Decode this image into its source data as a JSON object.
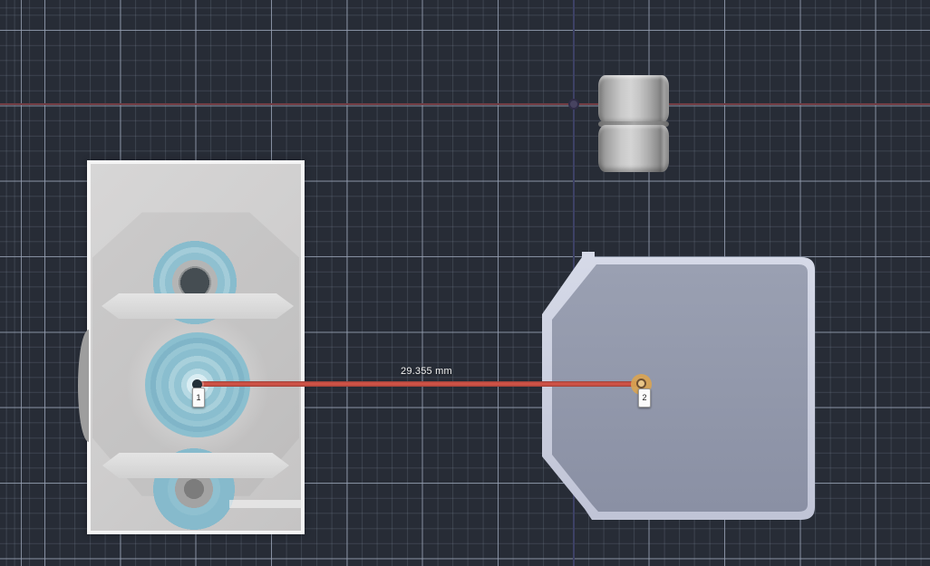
{
  "measurement": {
    "value": "29.355 mm",
    "point1": "1",
    "point2": "2"
  },
  "theme": {
    "grid-bg": "#272c36",
    "grid-minor": "rgba(136,148,166,0.22)",
    "grid-major": "rgba(152,162,180,0.8)",
    "axis-red": "#723c43",
    "axis-blue": "#3d4165",
    "measure-red": "#d05348",
    "measure-red-dark": "#9c4038",
    "highlight-orange": "#d9a453",
    "bore-blue": "#8fc0d0",
    "part-rim": "#f5f5f5",
    "part-face": "#d0cfcf",
    "plate-rim": "#cdd1e0",
    "plate-face": "#9096aa",
    "metal-mid": "#c9c9c9",
    "tag-bg": "#fbfbfb",
    "label-text": "#f2f2f2"
  }
}
